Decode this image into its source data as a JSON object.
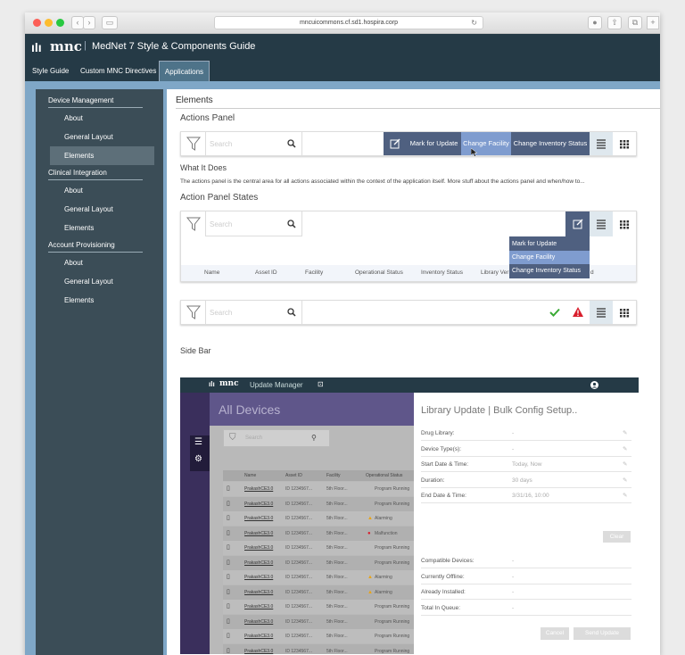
{
  "browser": {
    "url": "mncuicommons.cf.sd1.hospira.corp"
  },
  "app": {
    "logo": "mnc",
    "title": "MedNet 7 Style & Components Guide"
  },
  "tabs": [
    "Style Guide",
    "Custom MNC Directives",
    "Applications"
  ],
  "sidebar": {
    "sections": [
      {
        "title": "Device Management",
        "items": [
          "About",
          "General Layout",
          "Elements"
        ]
      },
      {
        "title": "Clinical Integration",
        "items": [
          "About",
          "General Layout",
          "Elements"
        ]
      },
      {
        "title": "Account Provisioning",
        "items": [
          "About",
          "General Layout",
          "Elements"
        ]
      }
    ]
  },
  "main": {
    "heading": "Elements",
    "actions_panel_title": "Actions Panel",
    "search_placeholder": "Search",
    "actions": {
      "mark": "Mark for Update",
      "change_facility": "Change Facility",
      "change_status": "Change Inventory Status"
    },
    "what_title": "What It Does",
    "what_text": "The actions panel is the central area for all actions associated within the context of the application itself. More stuff about the actions panel and when/how to...",
    "states_title": "Action Panel States",
    "table_headers": [
      "Name",
      "Asset ID",
      "Facility",
      "Operational Status",
      "Inventory Status",
      "Library Ver",
      "d"
    ],
    "sidebar_title": "Side Bar"
  },
  "screenshot": {
    "logo": "mnc",
    "app_name": "Update Manager",
    "left_title": "All Devices",
    "search_placeholder": "Search",
    "columns": [
      "Name",
      "Asset ID",
      "Facility",
      "Operational Status"
    ],
    "rows": [
      {
        "name": "PrakashCE3.0",
        "asset": "ID 1234567...",
        "facility": "5th Floor...",
        "status": "Program Running",
        "alert": ""
      },
      {
        "name": "PrakashCE3.0",
        "asset": "ID 1234567...",
        "facility": "5th Floor...",
        "status": "Program Running",
        "alert": ""
      },
      {
        "name": "PrakashCE3.0",
        "asset": "ID 1234567...",
        "facility": "5th Floor...",
        "status": "Alarming",
        "alert": "warn"
      },
      {
        "name": "PrakashCE3.0",
        "asset": "ID 1234567...",
        "facility": "5th Floor...",
        "status": "Malfunction",
        "alert": "error"
      },
      {
        "name": "PrakashCE3.0",
        "asset": "ID 1234567...",
        "facility": "5th Floor...",
        "status": "Program Running",
        "alert": ""
      },
      {
        "name": "PrakashCE3.0",
        "asset": "ID 1234567...",
        "facility": "5th Floor...",
        "status": "Program Running",
        "alert": ""
      },
      {
        "name": "PrakashCE3.0",
        "asset": "ID 1234567...",
        "facility": "5th Floor...",
        "status": "Alarming",
        "alert": "warn"
      },
      {
        "name": "PrakashCE3.0",
        "asset": "ID 1234567...",
        "facility": "5th Floor...",
        "status": "Alarming",
        "alert": "warn"
      },
      {
        "name": "PrakashCE3.0",
        "asset": "ID 1234567...",
        "facility": "5th Floor...",
        "status": "Program Running",
        "alert": ""
      },
      {
        "name": "PrakashCE3.0",
        "asset": "ID 1234567...",
        "facility": "5th Floor...",
        "status": "Program Running",
        "alert": ""
      },
      {
        "name": "PrakashCE3.0",
        "asset": "ID 1234567...",
        "facility": "5th Floor...",
        "status": "Program Running",
        "alert": ""
      },
      {
        "name": "PrakashCE3.0",
        "asset": "ID 1234567...",
        "facility": "5th Floor...",
        "status": "Program Running",
        "alert": ""
      }
    ],
    "flyout_title": "Library Update | Bulk Config Setup..",
    "fields": [
      {
        "label": "Drug Library:",
        "value": "-",
        "edit": true
      },
      {
        "label": "Device Type(s):",
        "value": "-",
        "edit": true
      },
      {
        "label": "Start Date & Time:",
        "value": "Today, Now",
        "edit": true
      },
      {
        "label": "Duration:",
        "value": "30 days",
        "edit": true
      },
      {
        "label": "End Date & Time:",
        "value": "3/31/16, 10:00",
        "edit": true
      }
    ],
    "clear_label": "Clear",
    "stats": [
      {
        "label": "Compatible Devices:",
        "value": "-"
      },
      {
        "label": "Currently Offline:",
        "value": "-"
      },
      {
        "label": "Already Installed:",
        "value": "-"
      },
      {
        "label": "Total In Queue:",
        "value": "-"
      }
    ],
    "cancel_label": "Cancel",
    "send_label": "Send Update"
  },
  "colors": {
    "header": "#253a46",
    "sidebar": "#3b4d57",
    "action_bar": "#4f6080",
    "highlight": "#7f9ccf",
    "ok": "#3aaa35",
    "error": "#d81e2c"
  }
}
